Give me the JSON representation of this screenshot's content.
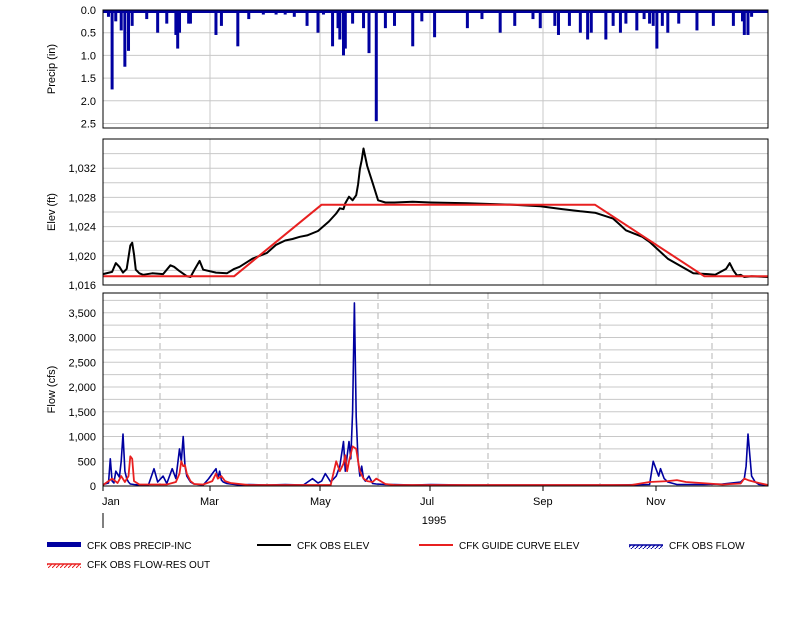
{
  "colors": {
    "precip": "#0000a0",
    "elev": "#000000",
    "guide": "#e82020",
    "flow": "#0000a0",
    "resout": "#e82020",
    "grid": "#c8c8c8",
    "dash": "#b4b4b4"
  },
  "year_label": "1995",
  "month_ticks": [
    "Jan",
    "Mar",
    "May",
    "Jul",
    "Sep",
    "Nov"
  ],
  "legend": [
    {
      "label": "CFK OBS PRECIP-INC",
      "style": "thickbar",
      "color": "#0000a0"
    },
    {
      "label": "CFK OBS ELEV",
      "style": "line",
      "color": "#000000"
    },
    {
      "label": "CFK GUIDE CURVE ELEV",
      "style": "line",
      "color": "#e82020"
    },
    {
      "label": "CFK OBS FLOW",
      "style": "hatch",
      "color": "#0000a0"
    },
    {
      "label": "CFK OBS FLOW-RES OUT",
      "style": "hatch",
      "color": "#e82020"
    }
  ],
  "chart_data": [
    {
      "type": "bar",
      "ylabel": "Precip (in)",
      "yticks": [
        "0.0",
        "0.5",
        "1.0",
        "1.5",
        "2.0",
        "2.5"
      ],
      "ylim": [
        0,
        2.6
      ],
      "inverted": true,
      "series": [
        {
          "name": "CFK OBS PRECIP-INC",
          "x_day": [
            3,
            5,
            7,
            10,
            12,
            14,
            16,
            24,
            30,
            35,
            40,
            41,
            42,
            47,
            48,
            62,
            65,
            74,
            80,
            88,
            95,
            100,
            105,
            112,
            118,
            121,
            126,
            129,
            130,
            132,
            133,
            137,
            143,
            146,
            150,
            155,
            160,
            170,
            175,
            182,
            200,
            208,
            218,
            226,
            236,
            240,
            248,
            250,
            256,
            262,
            266,
            268,
            276,
            280,
            284,
            287,
            293,
            297,
            300,
            302,
            304,
            307,
            310,
            316,
            326,
            335,
            346,
            351,
            352,
            354,
            356,
            360
          ],
          "values": [
            0.15,
            1.75,
            0.25,
            0.45,
            1.25,
            0.9,
            0.35,
            0.2,
            0.5,
            0.3,
            0.55,
            0.85,
            0.5,
            0.3,
            0.3,
            0.55,
            0.35,
            0.8,
            0.2,
            0.1,
            0.1,
            0.1,
            0.15,
            0.35,
            0.5,
            0.1,
            0.8,
            0.4,
            0.65,
            1.0,
            0.85,
            0.3,
            0.4,
            0.95,
            2.45,
            0.4,
            0.35,
            0.8,
            0.25,
            0.6,
            0.4,
            0.2,
            0.5,
            0.35,
            0.2,
            0.4,
            0.35,
            0.55,
            0.35,
            0.5,
            0.65,
            0.5,
            0.65,
            0.35,
            0.5,
            0.3,
            0.45,
            0.2,
            0.3,
            0.35,
            0.85,
            0.35,
            0.5,
            0.3,
            0.45,
            0.35,
            0.35,
            0.25,
            0.55,
            0.55,
            0.15,
            0.05
          ]
        }
      ]
    },
    {
      "type": "line",
      "ylabel": "Elev (ft)",
      "yticks": [
        "1,016",
        "1,020",
        "1,024",
        "1,028",
        "1,032"
      ],
      "ylim": [
        1016,
        1036
      ],
      "series": [
        {
          "name": "CFK OBS ELEV",
          "x_day": [
            0,
            5,
            7,
            9,
            11,
            13,
            15,
            16,
            17,
            18,
            20,
            22,
            27,
            33,
            37,
            39,
            42,
            46,
            48,
            50,
            53,
            55,
            62,
            68,
            72,
            75,
            82,
            90,
            95,
            100,
            104,
            108,
            112,
            118,
            124,
            128,
            130,
            132,
            133,
            135,
            137,
            139,
            140,
            141,
            142,
            143,
            145,
            148,
            151,
            155,
            160,
            170,
            180,
            200,
            225,
            240,
            252,
            262,
            270,
            280,
            284,
            287,
            292,
            296,
            300,
            310,
            324,
            332,
            336,
            342,
            344,
            346,
            348,
            350,
            352,
            356,
            365
          ],
          "values": [
            1017.5,
            1017.8,
            1019.0,
            1018.5,
            1017.7,
            1018.2,
            1021.4,
            1021.8,
            1020.2,
            1018.1,
            1017.6,
            1017.4,
            1017.6,
            1017.5,
            1018.7,
            1018.5,
            1017.9,
            1017.2,
            1017.1,
            1018.0,
            1019.3,
            1018.1,
            1017.7,
            1017.6,
            1018.2,
            1018.5,
            1019.6,
            1020.4,
            1021.5,
            1022.1,
            1022.3,
            1022.6,
            1022.8,
            1023.4,
            1024.7,
            1025.8,
            1026.5,
            1026.4,
            1027.2,
            1028.1,
            1027.6,
            1028.3,
            1029.8,
            1031.9,
            1033.1,
            1034.7,
            1032.3,
            1030.0,
            1027.6,
            1027.3,
            1027.3,
            1027.4,
            1027.3,
            1027.2,
            1027.0,
            1026.8,
            1026.4,
            1026.1,
            1025.9,
            1025.1,
            1024.2,
            1023.5,
            1023.0,
            1022.6,
            1021.9,
            1019.6,
            1017.6,
            1017.5,
            1017.4,
            1018.2,
            1019.0,
            1018.0,
            1017.3,
            1017.4,
            1017.1,
            1017.2,
            1017.1
          ]
        },
        {
          "name": "CFK GUIDE CURVE ELEV",
          "x_day": [
            0,
            72,
            120,
            270,
            330,
            365
          ],
          "values": [
            1017.2,
            1017.2,
            1027.0,
            1027.0,
            1017.2,
            1017.2
          ]
        }
      ]
    },
    {
      "type": "line",
      "ylabel": "Flow (cfs)",
      "yticks": [
        "0",
        "500",
        "1,000",
        "1,500",
        "2,000",
        "2,500",
        "3,000",
        "3,500"
      ],
      "ylim": [
        0,
        3900
      ],
      "series": [
        {
          "name": "CFK OBS FLOW",
          "x_day": [
            0,
            3,
            4,
            5,
            6,
            7,
            9,
            10,
            11,
            12,
            13,
            14,
            15,
            17,
            20,
            25,
            28,
            30,
            33,
            35,
            38,
            40,
            42,
            43,
            44,
            45,
            46,
            48,
            50,
            55,
            58,
            60,
            62,
            63,
            64,
            65,
            66,
            68,
            70,
            75,
            80,
            90,
            100,
            110,
            115,
            118,
            120,
            122,
            125,
            128,
            130,
            132,
            133,
            134,
            135,
            136,
            137,
            138,
            139,
            140,
            141,
            142,
            143,
            144,
            146,
            148,
            150,
            155,
            160,
            170,
            180,
            200,
            220,
            240,
            260,
            280,
            300,
            302,
            305,
            306,
            308,
            310,
            315,
            320,
            330,
            340,
            345,
            350,
            352,
            353,
            354,
            356,
            358,
            360,
            365
          ],
          "values": [
            30,
            60,
            550,
            100,
            60,
            300,
            180,
            500,
            1050,
            300,
            150,
            80,
            40,
            30,
            20,
            25,
            350,
            80,
            200,
            50,
            350,
            150,
            750,
            500,
            1000,
            400,
            200,
            80,
            40,
            20,
            150,
            250,
            350,
            150,
            300,
            120,
            80,
            50,
            40,
            20,
            30,
            20,
            30,
            20,
            150,
            60,
            100,
            250,
            80,
            200,
            400,
            900,
            300,
            600,
            900,
            550,
            1500,
            3700,
            1400,
            500,
            200,
            400,
            150,
            100,
            200,
            50,
            40,
            30,
            30,
            20,
            30,
            20,
            20,
            20,
            20,
            20,
            30,
            500,
            200,
            350,
            150,
            80,
            30,
            30,
            30,
            40,
            60,
            80,
            150,
            400,
            1050,
            200,
            80,
            30,
            20
          ]
        },
        {
          "name": "CFK OBS FLOW-RES OUT",
          "x_day": [
            0,
            5,
            8,
            10,
            12,
            14,
            15,
            16,
            17,
            20,
            25,
            30,
            35,
            40,
            42,
            43,
            44,
            45,
            46,
            48,
            50,
            55,
            60,
            62,
            63,
            65,
            67,
            70,
            80,
            100,
            125,
            128,
            130,
            132,
            133,
            134,
            135,
            137,
            139,
            140,
            141,
            143,
            145,
            148,
            150,
            155,
            160,
            175,
            200,
            250,
            290,
            295,
            300,
            310,
            315,
            320,
            340,
            350,
            352,
            354,
            356,
            360,
            365
          ],
          "values": [
            20,
            150,
            60,
            200,
            80,
            200,
            600,
            550,
            100,
            30,
            30,
            30,
            30,
            80,
            250,
            500,
            400,
            420,
            250,
            100,
            40,
            30,
            100,
            250,
            150,
            200,
            100,
            60,
            20,
            20,
            20,
            500,
            300,
            450,
            620,
            300,
            500,
            800,
            750,
            500,
            300,
            150,
            100,
            80,
            150,
            40,
            20,
            20,
            20,
            20,
            20,
            50,
            80,
            100,
            120,
            80,
            30,
            50,
            150,
            120,
            100,
            60,
            20
          ]
        }
      ]
    }
  ]
}
